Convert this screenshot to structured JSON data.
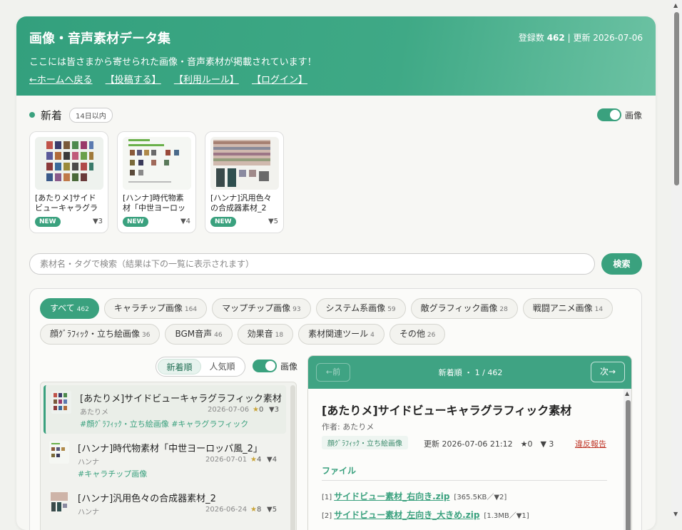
{
  "header": {
    "title": "画像・音声素材データ集",
    "meta_prefix": "登録数 ",
    "meta_count": "462",
    "meta_suffix": " | 更新 2026-07-06",
    "description": "ここには皆さまから寄せられた画像・音声素材が掲載されています！",
    "links": [
      "←ホームへ戻る",
      "【投稿する】",
      "【利用ルール】",
      "【ログイン】"
    ]
  },
  "new_section": {
    "title": "新着",
    "badge": "14日以内",
    "toggle_label": "画像",
    "items": [
      {
        "caption": "[あたりメ]サイドビューキャラグラフ",
        "badge": "NEW",
        "votes": "▼3"
      },
      {
        "caption": "[ハンナ]時代物素材「中世ヨーロッパ",
        "badge": "NEW",
        "votes": "▼4"
      },
      {
        "caption": "[ハンナ]汎用色々の合成器素材_2",
        "badge": "NEW",
        "votes": "▼5"
      }
    ]
  },
  "search": {
    "placeholder": "素材名・タグで検索（結果は下の一覧に表示されます）",
    "button": "検索"
  },
  "categories": [
    {
      "label": "すべて",
      "count": "462",
      "active": true
    },
    {
      "label": "キャラチップ画像",
      "count": "164"
    },
    {
      "label": "マップチップ画像",
      "count": "93"
    },
    {
      "label": "システム系画像",
      "count": "59"
    },
    {
      "label": "敵グラフィック画像",
      "count": "28"
    },
    {
      "label": "戦闘アニメ画像",
      "count": "14"
    },
    {
      "label": "顔ｸﾞﾗﾌｨｯｸ・立ち絵画像",
      "count": "36"
    },
    {
      "label": "BGM音声",
      "count": "46"
    },
    {
      "label": "効果音",
      "count": "18"
    },
    {
      "label": "素材関連ツール",
      "count": "4"
    },
    {
      "label": "その他",
      "count": "26"
    }
  ],
  "sort": {
    "options": [
      "新着順",
      "人気順"
    ],
    "toggle_label": "画像"
  },
  "list": [
    {
      "title": "[あたりメ]サイドビューキャラグラフィック素材",
      "author": "あたりメ",
      "date": "2026-07-06",
      "star": "★",
      "stars": "0",
      "votes": "▼3",
      "tags": "#顔ｸﾞﾗﾌｨｯｸ・立ち絵画像 #キャラグラフィック"
    },
    {
      "title": "[ハンナ]時代物素材「中世ヨーロッパ風_2」",
      "author": "ハンナ",
      "date": "2026-07-01",
      "star": "★",
      "stars": "4",
      "votes": "▼4",
      "tags": "#キャラチップ画像"
    },
    {
      "title": "[ハンナ]汎用色々の合成器素材_2",
      "author": "ハンナ",
      "date": "2026-06-24",
      "star": "★",
      "stars": "8",
      "votes": "▼5",
      "tags": ""
    }
  ],
  "detail": {
    "prev": "←前",
    "position": "新着順 ・ 1 / 462",
    "next": "次→",
    "title": "[あたりメ]サイドビューキャラグラフィック素材",
    "author": "作者: あたりメ",
    "tag": "顔ｸﾞﾗﾌｨｯｸ・立ち絵画像",
    "updated": "更新 2026-07-06 21:12　★0　▼ 3",
    "report": "違反報告",
    "files_heading": "ファイル",
    "files": [
      {
        "index": "[1]",
        "name": "サイドビュー素材_右向き.zip",
        "info": "[365.5KB／▼2]"
      },
      {
        "index": "[2]",
        "name": "サイドビュー素材_左向き_大きめ.zip",
        "info": "[1.3MB／▼1]"
      }
    ]
  },
  "colors": {
    "accent": "#3aa17e",
    "header_end": "#6cc2a3",
    "report": "#c0392b"
  }
}
